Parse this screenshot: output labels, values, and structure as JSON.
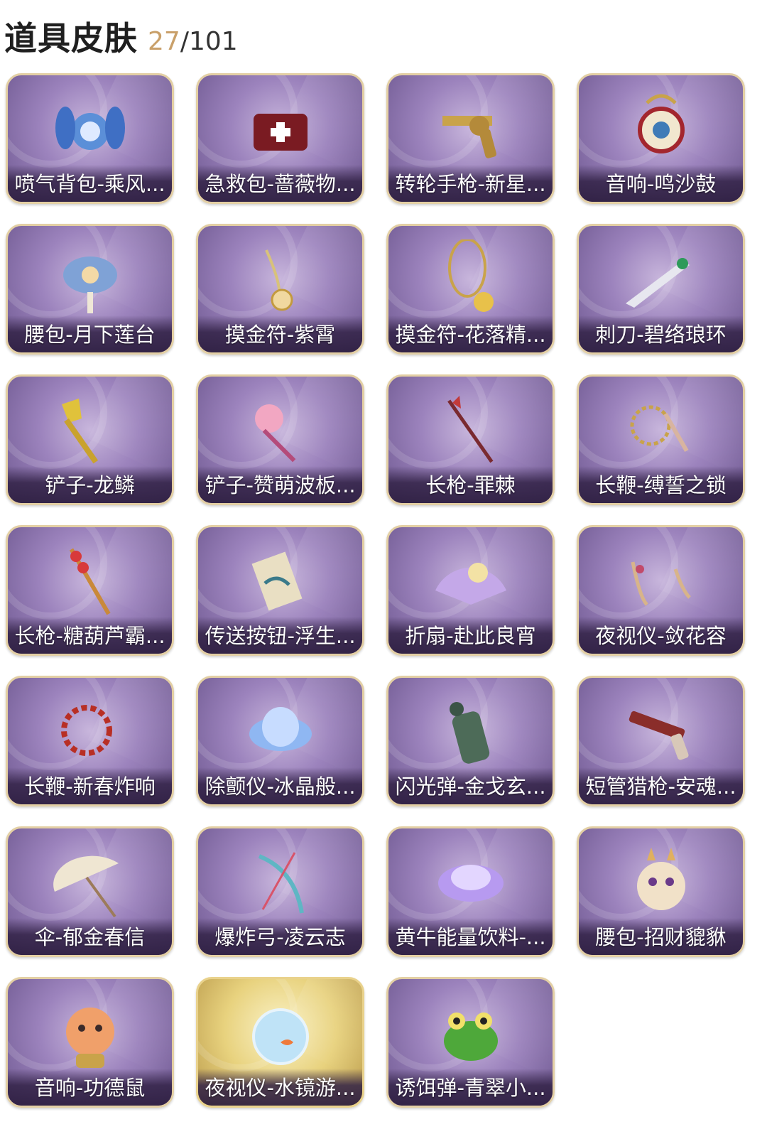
{
  "header": {
    "title": "道具皮肤",
    "owned": "27",
    "separator": "/",
    "total": "101"
  },
  "colors": {
    "accent": "#c9a06a",
    "card_purple": "#9c83bd",
    "card_border": "#e3cfa4",
    "card_gold": "#e8d27e"
  },
  "items": [
    {
      "label": "喷气背包-乘风...",
      "icon": "jetpack-icon",
      "rarity": "purple"
    },
    {
      "label": "急救包-蔷薇物...",
      "icon": "medkit-icon",
      "rarity": "purple"
    },
    {
      "label": "转轮手枪-新星...",
      "icon": "revolver-icon",
      "rarity": "purple"
    },
    {
      "label": "音响-鸣沙鼓",
      "icon": "drum-icon",
      "rarity": "purple"
    },
    {
      "label": "腰包-月下莲台",
      "icon": "waist-pack-icon",
      "rarity": "purple"
    },
    {
      "label": "摸金符-紫霄",
      "icon": "amulet-icon",
      "rarity": "purple"
    },
    {
      "label": "摸金符-花落精...",
      "icon": "flower-amulet-icon",
      "rarity": "purple"
    },
    {
      "label": "刺刀-碧络琅环",
      "icon": "bayonet-icon",
      "rarity": "purple"
    },
    {
      "label": "铲子-龙鳞",
      "icon": "shovel-icon",
      "rarity": "purple"
    },
    {
      "label": "铲子-赞萌波板...",
      "icon": "cute-shovel-icon",
      "rarity": "purple"
    },
    {
      "label": "长枪-罪棘",
      "icon": "spear-icon",
      "rarity": "purple"
    },
    {
      "label": "长鞭-缚誓之锁",
      "icon": "chain-whip-icon",
      "rarity": "purple"
    },
    {
      "label": "长枪-糖葫芦霸...",
      "icon": "candy-spear-icon",
      "rarity": "purple"
    },
    {
      "label": "传送按钮-浮生...",
      "icon": "scroll-icon",
      "rarity": "purple"
    },
    {
      "label": "折扇-赴此良宵",
      "icon": "fan-icon",
      "rarity": "purple"
    },
    {
      "label": "夜视仪-敛花容",
      "icon": "goggles-icon",
      "rarity": "purple"
    },
    {
      "label": "长鞭-新春炸响",
      "icon": "firecracker-whip-icon",
      "rarity": "purple"
    },
    {
      "label": "除颤仪-冰晶般...",
      "icon": "lotus-icon",
      "rarity": "purple"
    },
    {
      "label": "闪光弹-金戈玄...",
      "icon": "grenade-icon",
      "rarity": "purple"
    },
    {
      "label": "短管猎枪-安魂...",
      "icon": "shotgun-icon",
      "rarity": "purple"
    },
    {
      "label": "伞-郁金春信",
      "icon": "umbrella-icon",
      "rarity": "purple"
    },
    {
      "label": "爆炸弓-凌云志",
      "icon": "bow-icon",
      "rarity": "purple"
    },
    {
      "label": "黄牛能量饮料-...",
      "icon": "energy-drink-icon",
      "rarity": "purple"
    },
    {
      "label": "腰包-招财貔貅",
      "icon": "pixiu-icon",
      "rarity": "purple"
    },
    {
      "label": "音响-功德鼠",
      "icon": "hamster-icon",
      "rarity": "purple"
    },
    {
      "label": "夜视仪-水镜游...",
      "icon": "fishbowl-icon",
      "rarity": "gold"
    },
    {
      "label": "诱饵弹-青翠小...",
      "icon": "frog-icon",
      "rarity": "purple"
    }
  ]
}
